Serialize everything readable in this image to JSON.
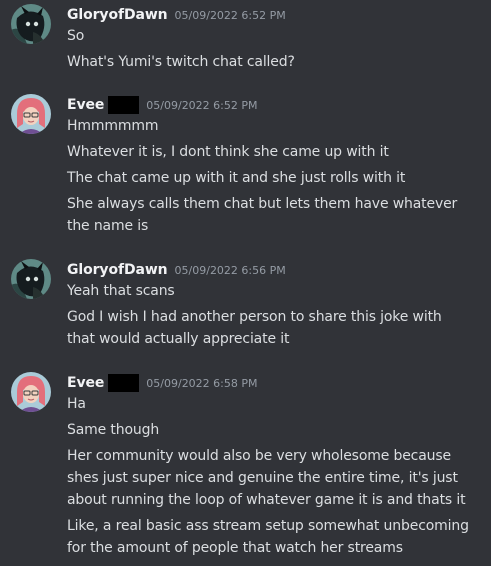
{
  "messages": [
    {
      "username": "GloryofDawn",
      "timestamp": "05/09/2022 6:52 PM",
      "avatar_icon": "dark-character-avatar-icon",
      "lines": [
        "So",
        "What's Yumi's twitch chat called?"
      ]
    },
    {
      "username": "Evee",
      "timestamp": "05/09/2022 6:52 PM",
      "avatar_icon": "pink-haired-character-avatar-icon",
      "lines": [
        "Hmmmmmm",
        "Whatever it is, I dont think she came up with it",
        "The chat came up with it and she just rolls with it",
        "She always calls them chat but lets them have whatever",
        "the name is"
      ]
    },
    {
      "username": "GloryofDawn",
      "timestamp": "05/09/2022 6:56 PM",
      "avatar_icon": "dark-character-avatar-icon",
      "lines": [
        "Yeah that scans",
        "God I wish I had another person to share this joke with",
        "that would actually appreciate it"
      ]
    },
    {
      "username": "Evee",
      "timestamp": "05/09/2022 6:58 PM",
      "avatar_icon": "pink-haired-character-avatar-icon",
      "lines": [
        "Ha",
        "Same though",
        "Her community would also be very wholesome because",
        "shes just super nice and genuine the entire time, it's just",
        "about running the loop of whatever game it is and thats it",
        "Like, a real basic ass stream setup somewhat unbecoming",
        "for the amount of people that watch her streams"
      ]
    }
  ],
  "colors": {
    "background": "#313338",
    "username": "#f2f3f5",
    "timestamp": "#949ba4",
    "text": "#dbdee1",
    "redaction": "#000000"
  }
}
